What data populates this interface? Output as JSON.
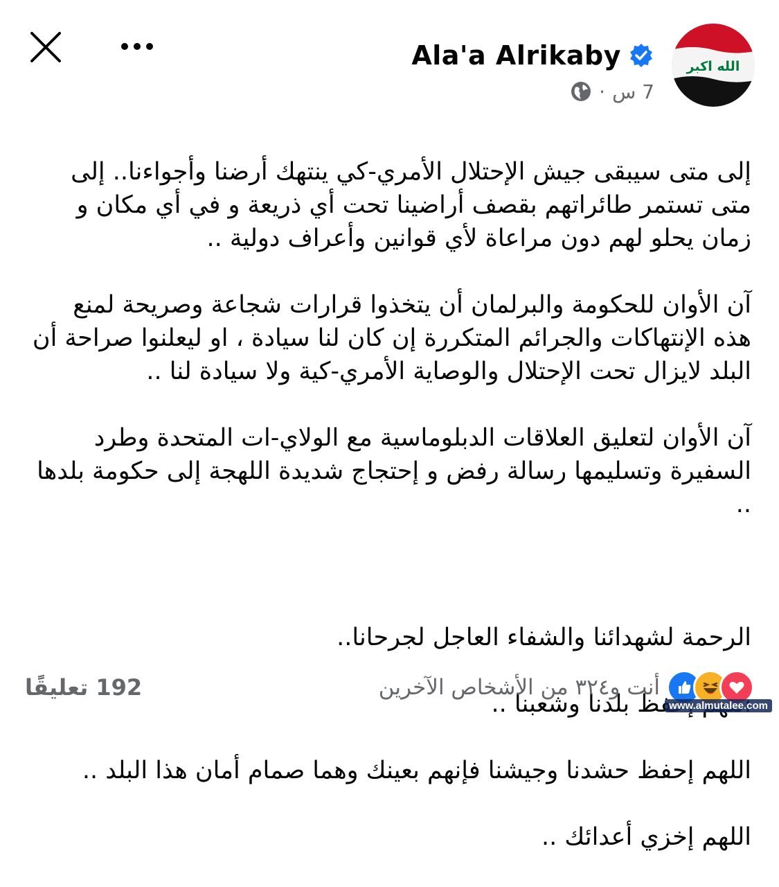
{
  "header": {
    "close_icon": "close-icon",
    "more_icon": "more-horizontal-icon"
  },
  "author": {
    "name": "Ala'a Alrikaby",
    "verified_icon": "verified-badge-icon",
    "avatar_flag_text": "الله اكبر"
  },
  "meta": {
    "time": "7 س",
    "separator": "·",
    "audience_icon": "globe-icon"
  },
  "post": {
    "paragraphs": [
      "إلى متى سيبقى جيش الإحتلال الأمري-كي ينتهك أرضنا وأجواءنا.. إلى متى تستمر طائراتهم بقصف أراضينا تحت أي ذريعة و في أي مكان و زمان يحلو لهم دون مراعاة لأي قوانين وأعراف دولية ..",
      "آن الأوان للحكومة والبرلمان أن يتخذوا قرارات شجاعة وصريحة لمنع هذه الإنتهاكات والجرائم المتكررة إن كان لنا سيادة ، او ليعلنوا صراحة أن البلد لايزال تحت الإحتلال والوصاية الأمري-كية ولا سيادة لنا ..",
      "آن الأوان لتعليق العلاقات الدبلوماسية مع الولاي-ات المتحدة وطرد السفيرة وتسليمها رسالة رفض و إحتجاج شديدة اللهجة إلى حكومة بلدها ..",
      "",
      "الرحمة لشهدائنا والشفاء العاجل لجرحانا..",
      "اللهم إحفظ بلدنا وشعبنا ..",
      "اللهم إحفظ حشدنا وجيشنا فإنهم بعينك وهما صمام أمان هذا البلد ..",
      "اللهم إخزي أعدائك .."
    ]
  },
  "footer": {
    "reactions_text": "أنت و٣٢٤ من الأشخاص الآخرين",
    "reaction_icons": [
      "like-icon",
      "haha-icon",
      "love-icon"
    ],
    "comments_count": "192",
    "comments_label": "تعليقًا"
  },
  "watermark": "www.almutalee.com",
  "colors": {
    "text": "#050505",
    "secondary": "#65676b",
    "verified": "#1877f2",
    "like": "#1877f2",
    "love": "#f33e58",
    "haha": "#f7b125"
  }
}
